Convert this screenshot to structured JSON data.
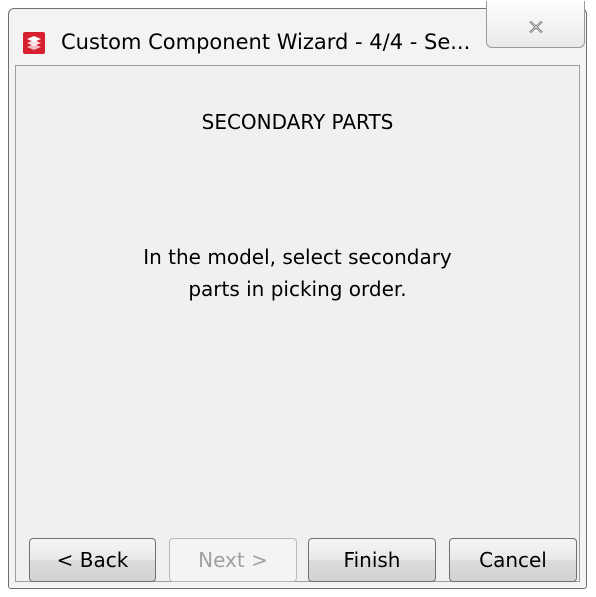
{
  "window": {
    "title": "Custom Component Wizard - 4/4 - Se...",
    "close_icon": "close-x-icon",
    "app_icon": "tekla-logo-icon"
  },
  "content": {
    "heading": "SECONDARY PARTS",
    "message_line1": "In the model, select secondary",
    "message_line2": "parts in picking order."
  },
  "buttons": {
    "back": "< Back",
    "next": "Next >",
    "finish": "Finish",
    "cancel": "Cancel",
    "next_enabled": false
  },
  "colors": {
    "window_bg": "#f0f0f0",
    "disabled_text": "#a0a0a0",
    "app_icon_red": "#d6202f"
  }
}
